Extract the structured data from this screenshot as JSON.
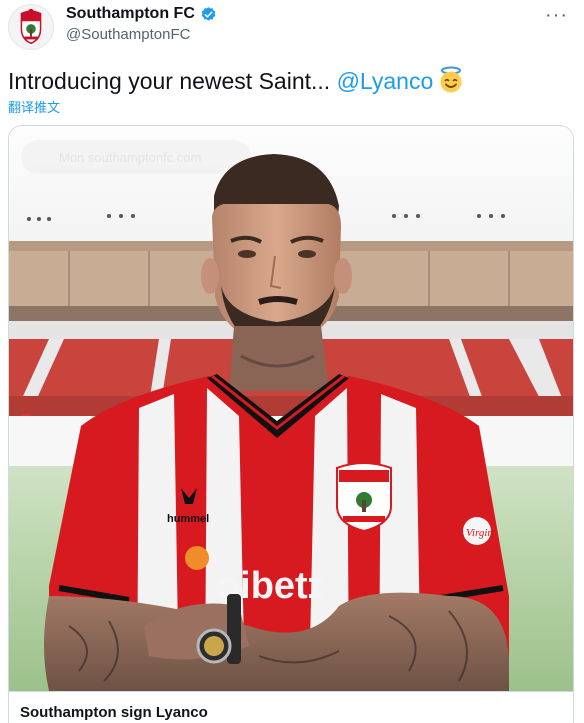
{
  "account": {
    "display_name": "Southampton FC",
    "handle": "@SouthamptonFC",
    "verified": true,
    "avatar_icon": "southampton-crest-icon",
    "verified_icon": "verified-badge-icon",
    "more_icon": "ellipsis-icon",
    "more_glyph": "···"
  },
  "tweet": {
    "text_prefix": "Introducing your newest Saint... ",
    "mention": "@Lyanco",
    "emoji_icon": "smiling-face-with-halo-icon",
    "translate_label": "翻译推文"
  },
  "card": {
    "video_overlay_text": "Mon southamptonfc.com",
    "title": "Southampton sign Lyanco",
    "kit_sponsor_text": "Bitcoin-bet",
    "kit_sponsor_visible": "ɔibetɪ",
    "kit_brand": "hummel",
    "sleeve_sponsor": "Virgin"
  },
  "colors": {
    "accent": "#1d9bf0",
    "text": "#0f1419",
    "muted": "#536471",
    "saints_red": "#d71920",
    "border": "#cfd9de"
  }
}
